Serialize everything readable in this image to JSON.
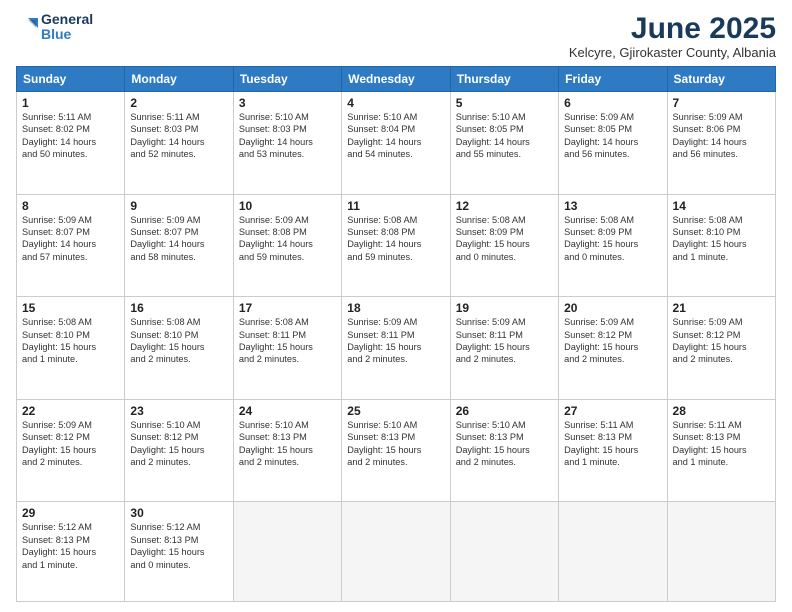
{
  "logo": {
    "line1": "General",
    "line2": "Blue"
  },
  "title": "June 2025",
  "subtitle": "Kelcyre, Gjirokaster County, Albania",
  "headers": [
    "Sunday",
    "Monday",
    "Tuesday",
    "Wednesday",
    "Thursday",
    "Friday",
    "Saturday"
  ],
  "weeks": [
    [
      {
        "day": "1",
        "info": "Sunrise: 5:11 AM\nSunset: 8:02 PM\nDaylight: 14 hours\nand 50 minutes."
      },
      {
        "day": "2",
        "info": "Sunrise: 5:11 AM\nSunset: 8:03 PM\nDaylight: 14 hours\nand 52 minutes."
      },
      {
        "day": "3",
        "info": "Sunrise: 5:10 AM\nSunset: 8:03 PM\nDaylight: 14 hours\nand 53 minutes."
      },
      {
        "day": "4",
        "info": "Sunrise: 5:10 AM\nSunset: 8:04 PM\nDaylight: 14 hours\nand 54 minutes."
      },
      {
        "day": "5",
        "info": "Sunrise: 5:10 AM\nSunset: 8:05 PM\nDaylight: 14 hours\nand 55 minutes."
      },
      {
        "day": "6",
        "info": "Sunrise: 5:09 AM\nSunset: 8:05 PM\nDaylight: 14 hours\nand 56 minutes."
      },
      {
        "day": "7",
        "info": "Sunrise: 5:09 AM\nSunset: 8:06 PM\nDaylight: 14 hours\nand 56 minutes."
      }
    ],
    [
      {
        "day": "8",
        "info": "Sunrise: 5:09 AM\nSunset: 8:07 PM\nDaylight: 14 hours\nand 57 minutes."
      },
      {
        "day": "9",
        "info": "Sunrise: 5:09 AM\nSunset: 8:07 PM\nDaylight: 14 hours\nand 58 minutes."
      },
      {
        "day": "10",
        "info": "Sunrise: 5:09 AM\nSunset: 8:08 PM\nDaylight: 14 hours\nand 59 minutes."
      },
      {
        "day": "11",
        "info": "Sunrise: 5:08 AM\nSunset: 8:08 PM\nDaylight: 14 hours\nand 59 minutes."
      },
      {
        "day": "12",
        "info": "Sunrise: 5:08 AM\nSunset: 8:09 PM\nDaylight: 15 hours\nand 0 minutes."
      },
      {
        "day": "13",
        "info": "Sunrise: 5:08 AM\nSunset: 8:09 PM\nDaylight: 15 hours\nand 0 minutes."
      },
      {
        "day": "14",
        "info": "Sunrise: 5:08 AM\nSunset: 8:10 PM\nDaylight: 15 hours\nand 1 minute."
      }
    ],
    [
      {
        "day": "15",
        "info": "Sunrise: 5:08 AM\nSunset: 8:10 PM\nDaylight: 15 hours\nand 1 minute."
      },
      {
        "day": "16",
        "info": "Sunrise: 5:08 AM\nSunset: 8:10 PM\nDaylight: 15 hours\nand 2 minutes."
      },
      {
        "day": "17",
        "info": "Sunrise: 5:08 AM\nSunset: 8:11 PM\nDaylight: 15 hours\nand 2 minutes."
      },
      {
        "day": "18",
        "info": "Sunrise: 5:09 AM\nSunset: 8:11 PM\nDaylight: 15 hours\nand 2 minutes."
      },
      {
        "day": "19",
        "info": "Sunrise: 5:09 AM\nSunset: 8:11 PM\nDaylight: 15 hours\nand 2 minutes."
      },
      {
        "day": "20",
        "info": "Sunrise: 5:09 AM\nSunset: 8:12 PM\nDaylight: 15 hours\nand 2 minutes."
      },
      {
        "day": "21",
        "info": "Sunrise: 5:09 AM\nSunset: 8:12 PM\nDaylight: 15 hours\nand 2 minutes."
      }
    ],
    [
      {
        "day": "22",
        "info": "Sunrise: 5:09 AM\nSunset: 8:12 PM\nDaylight: 15 hours\nand 2 minutes."
      },
      {
        "day": "23",
        "info": "Sunrise: 5:10 AM\nSunset: 8:12 PM\nDaylight: 15 hours\nand 2 minutes."
      },
      {
        "day": "24",
        "info": "Sunrise: 5:10 AM\nSunset: 8:13 PM\nDaylight: 15 hours\nand 2 minutes."
      },
      {
        "day": "25",
        "info": "Sunrise: 5:10 AM\nSunset: 8:13 PM\nDaylight: 15 hours\nand 2 minutes."
      },
      {
        "day": "26",
        "info": "Sunrise: 5:10 AM\nSunset: 8:13 PM\nDaylight: 15 hours\nand 2 minutes."
      },
      {
        "day": "27",
        "info": "Sunrise: 5:11 AM\nSunset: 8:13 PM\nDaylight: 15 hours\nand 1 minute."
      },
      {
        "day": "28",
        "info": "Sunrise: 5:11 AM\nSunset: 8:13 PM\nDaylight: 15 hours\nand 1 minute."
      }
    ],
    [
      {
        "day": "29",
        "info": "Sunrise: 5:12 AM\nSunset: 8:13 PM\nDaylight: 15 hours\nand 1 minute."
      },
      {
        "day": "30",
        "info": "Sunrise: 5:12 AM\nSunset: 8:13 PM\nDaylight: 15 hours\nand 0 minutes."
      },
      {
        "day": "",
        "info": ""
      },
      {
        "day": "",
        "info": ""
      },
      {
        "day": "",
        "info": ""
      },
      {
        "day": "",
        "info": ""
      },
      {
        "day": "",
        "info": ""
      }
    ]
  ]
}
